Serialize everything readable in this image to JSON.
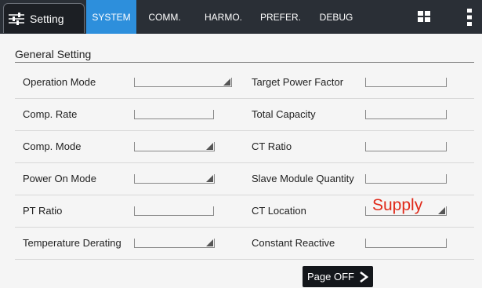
{
  "topbar": {
    "settings_label": "Setting",
    "tabs": [
      {
        "label": "SYSTEM",
        "active": true
      },
      {
        "label": "COMM."
      },
      {
        "label": "HARMO."
      },
      {
        "label": "PREFER."
      },
      {
        "label": "DEBUG"
      }
    ],
    "icons": [
      "sliders-icon",
      "grid-icon",
      "more-vertical-icon"
    ]
  },
  "section": {
    "title": "General Setting"
  },
  "fields_left": [
    {
      "label": "Operation Mode",
      "dropdown": true,
      "value": ""
    },
    {
      "label": "Comp. Rate",
      "dropdown": false,
      "value": ""
    },
    {
      "label": "Comp. Mode",
      "dropdown": true,
      "value": ""
    },
    {
      "label": "Power On Mode",
      "dropdown": true,
      "value": ""
    },
    {
      "label": "PT Ratio",
      "dropdown": false,
      "value": ""
    },
    {
      "label": "Temperature Derating",
      "dropdown": true,
      "value": ""
    }
  ],
  "fields_right": [
    {
      "label": "Target Power Factor",
      "dropdown": false,
      "value": ""
    },
    {
      "label": "Total Capacity",
      "dropdown": false,
      "value": ""
    },
    {
      "label": "CT Ratio",
      "dropdown": false,
      "value": ""
    },
    {
      "label": "Slave Module Quantity",
      "dropdown": false,
      "value": ""
    },
    {
      "label": "CT Location",
      "dropdown": true,
      "value": "Supply"
    },
    {
      "label": "Constant Reactive",
      "dropdown": false,
      "value": ""
    }
  ],
  "footer": {
    "page_button_label": "Page OFF",
    "page_button_icon": "chevron-right-icon"
  },
  "colors": {
    "accent": "#2d8fdc",
    "value_text": "#e02a1a",
    "topbar": "#2a2f36"
  }
}
